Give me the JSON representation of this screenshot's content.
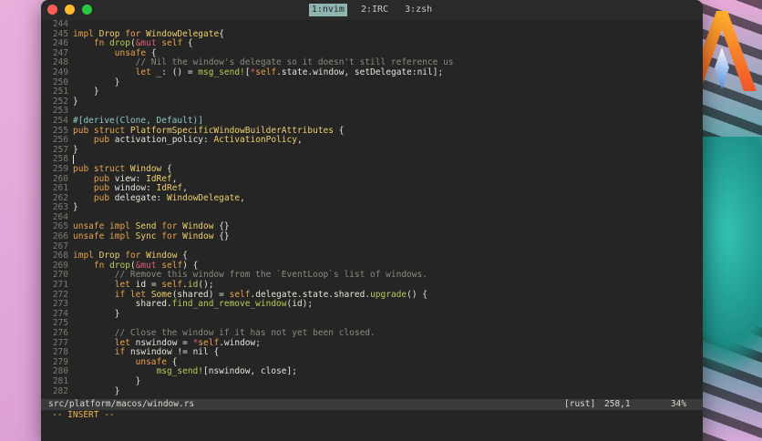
{
  "tmux": {
    "tabs": [
      {
        "label": "1:nvim",
        "active": true
      },
      {
        "label": "2:IRC",
        "active": false
      },
      {
        "label": "3:zsh",
        "active": false
      }
    ]
  },
  "editor": {
    "lines": [
      {
        "n": "244",
        "segs": []
      },
      {
        "n": "245",
        "segs": [
          [
            "k",
            "impl "
          ],
          [
            "t",
            "Drop "
          ],
          [
            "k",
            "for "
          ],
          [
            "t",
            "WindowDelegate"
          ],
          [
            "",
            "{"
          ]
        ]
      },
      {
        "n": "246",
        "segs": [
          [
            "",
            "    "
          ],
          [
            "k",
            "fn "
          ],
          [
            "f",
            "drop"
          ],
          [
            "",
            "("
          ],
          [
            "m",
            "&mut "
          ],
          [
            "k",
            "self"
          ],
          [
            "",
            " {"
          ]
        ]
      },
      {
        "n": "247",
        "segs": [
          [
            "",
            "        "
          ],
          [
            "k",
            "unsafe"
          ],
          [
            "",
            " {"
          ]
        ]
      },
      {
        "n": "248",
        "segs": [
          [
            "c",
            "            // Nil the window's delegate so it doesn't still reference us"
          ]
        ]
      },
      {
        "n": "249",
        "segs": [
          [
            "",
            "            "
          ],
          [
            "k",
            "let "
          ],
          [
            "",
            "_: () = "
          ],
          [
            "f",
            "msg_send!"
          ],
          [
            "",
            "["
          ],
          [
            "m",
            "*"
          ],
          [
            "k",
            "self"
          ],
          [
            "",
            ".state.window, setDelegate:nil];"
          ]
        ]
      },
      {
        "n": "250",
        "segs": [
          [
            "",
            "        }"
          ]
        ]
      },
      {
        "n": "251",
        "segs": [
          [
            "",
            "    }"
          ]
        ]
      },
      {
        "n": "252",
        "segs": [
          [
            "",
            "}"
          ]
        ]
      },
      {
        "n": "253",
        "segs": []
      },
      {
        "n": "254",
        "segs": [
          [
            "s",
            "#[derive(Clone, Default)]"
          ]
        ]
      },
      {
        "n": "255",
        "segs": [
          [
            "k",
            "pub struct "
          ],
          [
            "t",
            "PlatformSpecificWindowBuilderAttributes"
          ],
          [
            "",
            " {"
          ]
        ]
      },
      {
        "n": "256",
        "segs": [
          [
            "",
            "    "
          ],
          [
            "k",
            "pub "
          ],
          [
            "",
            "activation_policy: "
          ],
          [
            "t",
            "ActivationPolicy"
          ],
          [
            "",
            ","
          ]
        ]
      },
      {
        "n": "257",
        "segs": [
          [
            "",
            "}"
          ]
        ]
      },
      {
        "n": "258",
        "segs": [],
        "cursor": true
      },
      {
        "n": "259",
        "segs": [
          [
            "k",
            "pub struct "
          ],
          [
            "t",
            "Window"
          ],
          [
            "",
            " {"
          ]
        ]
      },
      {
        "n": "260",
        "segs": [
          [
            "",
            "    "
          ],
          [
            "k",
            "pub "
          ],
          [
            "",
            "view: "
          ],
          [
            "t",
            "IdRef"
          ],
          [
            "",
            ","
          ]
        ]
      },
      {
        "n": "261",
        "segs": [
          [
            "",
            "    "
          ],
          [
            "k",
            "pub "
          ],
          [
            "",
            "window: "
          ],
          [
            "t",
            "IdRef"
          ],
          [
            "",
            ","
          ]
        ]
      },
      {
        "n": "262",
        "segs": [
          [
            "",
            "    "
          ],
          [
            "k",
            "pub "
          ],
          [
            "",
            "delegate: "
          ],
          [
            "t",
            "WindowDelegate"
          ],
          [
            "",
            ","
          ]
        ]
      },
      {
        "n": "263",
        "segs": [
          [
            "",
            "}"
          ]
        ]
      },
      {
        "n": "264",
        "segs": []
      },
      {
        "n": "265",
        "segs": [
          [
            "k",
            "unsafe impl "
          ],
          [
            "t",
            "Send "
          ],
          [
            "k",
            "for "
          ],
          [
            "t",
            "Window "
          ],
          [
            "",
            "{}"
          ]
        ]
      },
      {
        "n": "266",
        "segs": [
          [
            "k",
            "unsafe impl "
          ],
          [
            "t",
            "Sync "
          ],
          [
            "k",
            "for "
          ],
          [
            "t",
            "Window "
          ],
          [
            "",
            "{}"
          ]
        ]
      },
      {
        "n": "267",
        "segs": []
      },
      {
        "n": "268",
        "segs": [
          [
            "k",
            "impl "
          ],
          [
            "t",
            "Drop "
          ],
          [
            "k",
            "for "
          ],
          [
            "t",
            "Window "
          ],
          [
            "",
            "{"
          ]
        ]
      },
      {
        "n": "269",
        "segs": [
          [
            "",
            "    "
          ],
          [
            "k",
            "fn "
          ],
          [
            "f",
            "drop"
          ],
          [
            "",
            "("
          ],
          [
            "m",
            "&mut "
          ],
          [
            "k",
            "self"
          ],
          [
            "",
            ") {"
          ]
        ]
      },
      {
        "n": "270",
        "segs": [
          [
            "c",
            "        // Remove this window from the `EventLoop`s list of windows."
          ]
        ]
      },
      {
        "n": "271",
        "segs": [
          [
            "",
            "        "
          ],
          [
            "k",
            "let "
          ],
          [
            "",
            "id = "
          ],
          [
            "k",
            "self"
          ],
          [
            "",
            "."
          ],
          [
            "f",
            "id"
          ],
          [
            "",
            "();"
          ]
        ]
      },
      {
        "n": "272",
        "segs": [
          [
            "",
            "        "
          ],
          [
            "k",
            "if let "
          ],
          [
            "t",
            "Some"
          ],
          [
            "",
            "(shared) = "
          ],
          [
            "k",
            "self"
          ],
          [
            "",
            ".delegate.state.shared."
          ],
          [
            "f",
            "upgrade"
          ],
          [
            "",
            "() {"
          ]
        ]
      },
      {
        "n": "273",
        "segs": [
          [
            "",
            "            shared."
          ],
          [
            "f",
            "find_and_remove_window"
          ],
          [
            "",
            "(id);"
          ]
        ]
      },
      {
        "n": "274",
        "segs": [
          [
            "",
            "        }"
          ]
        ]
      },
      {
        "n": "275",
        "segs": []
      },
      {
        "n": "276",
        "segs": [
          [
            "c",
            "        // Close the window if it has not yet been closed."
          ]
        ]
      },
      {
        "n": "277",
        "segs": [
          [
            "",
            "        "
          ],
          [
            "k",
            "let "
          ],
          [
            "",
            "nswindow = "
          ],
          [
            "m",
            "*"
          ],
          [
            "k",
            "self"
          ],
          [
            "",
            ".window;"
          ]
        ]
      },
      {
        "n": "278",
        "segs": [
          [
            "",
            "        "
          ],
          [
            "k",
            "if "
          ],
          [
            "",
            "nswindow != nil {"
          ]
        ]
      },
      {
        "n": "279",
        "segs": [
          [
            "",
            "            "
          ],
          [
            "k",
            "unsafe"
          ],
          [
            "",
            " {"
          ]
        ]
      },
      {
        "n": "280",
        "segs": [
          [
            "",
            "                "
          ],
          [
            "f",
            "msg_send!"
          ],
          [
            "",
            "[nswindow, close];"
          ]
        ]
      },
      {
        "n": "281",
        "segs": [
          [
            "",
            "            }"
          ]
        ]
      },
      {
        "n": "282",
        "segs": [
          [
            "",
            "        }"
          ]
        ]
      }
    ]
  },
  "statusline": {
    "file": "src/platform/macos/window.rs",
    "filetype": "[rust]",
    "position": "258,1",
    "percent": "34%"
  },
  "mode": {
    "label": "-- INSERT --"
  },
  "colors": {
    "keyword": "#e7a24b",
    "type": "#f0d06a",
    "function": "#b5cc56",
    "attribute": "#8fc9c5",
    "comment": "#8a8a7e",
    "modifier": "#e05a6e"
  },
  "icons": [
    "alacritty-logo-icon"
  ]
}
